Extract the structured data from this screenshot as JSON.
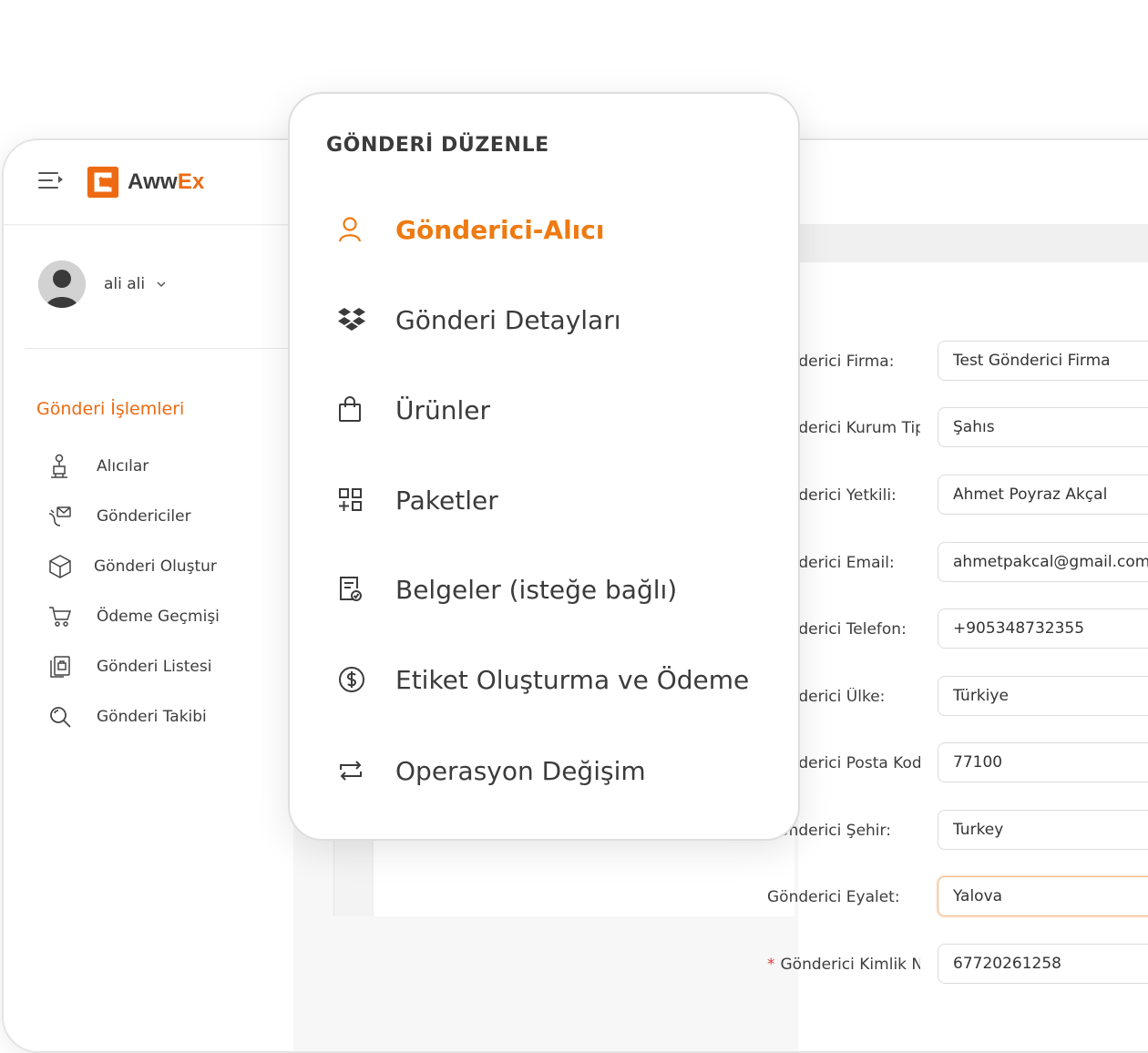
{
  "brand": {
    "name_part1": "Aww",
    "name_part2": "Ex",
    "accent": "#ee6a12"
  },
  "user": {
    "name": "ali ali"
  },
  "sidebar": {
    "section_title": "Gönderi İşlemleri",
    "items": [
      {
        "label": "Alıcılar",
        "icon": "receiver-icon"
      },
      {
        "label": "Göndericiler",
        "icon": "sender-icon"
      },
      {
        "label": "Gönderi Oluştur",
        "icon": "box-icon"
      },
      {
        "label": "Ödeme Geçmişi",
        "icon": "cart-icon"
      },
      {
        "label": "Gönderi Listesi",
        "icon": "list-icon"
      },
      {
        "label": "Gönderi Takibi",
        "icon": "search-icon"
      }
    ]
  },
  "popup": {
    "title": "GÖNDERİ DÜZENLE",
    "items": [
      {
        "label": "Gönderici-Alıcı",
        "icon": "user-icon",
        "active": true
      },
      {
        "label": "Gönderi Detayları",
        "icon": "dropbox-icon"
      },
      {
        "label": "Ürünler",
        "icon": "shopping-bag-icon"
      },
      {
        "label": "Paketler",
        "icon": "grid-add-icon"
      },
      {
        "label": "Belgeler (isteğe bağlı)",
        "icon": "document-check-icon"
      },
      {
        "label": "Etiket Oluşturma ve Ödeme",
        "icon": "dollar-circle-icon"
      },
      {
        "label": "Operasyon Değişim",
        "icon": "repeat-icon"
      }
    ]
  },
  "form": {
    "fields": [
      {
        "label": "Gönderici Firma:",
        "value": "Test Gönderici Firma"
      },
      {
        "label": "Gönderici Kurum Tipi:",
        "value": "Şahıs"
      },
      {
        "label": "Gönderici Yetkili:",
        "value": "Ahmet Poyraz Akçal"
      },
      {
        "label": "Gönderici Email:",
        "value": "ahmetpakcal@gmail.com"
      },
      {
        "label": "Gönderici Telefon:",
        "value": "+905348732355"
      },
      {
        "label": "Gönderici Ülke:",
        "value": "Türkiye"
      },
      {
        "label": "Gönderici Posta Kodu:",
        "value": "77100"
      },
      {
        "label": "Gönderici Şehir:",
        "value": "Turkey"
      },
      {
        "label": "Gönderici Eyalet:",
        "value": "Yalova"
      },
      {
        "label": "Gönderici Kimlik No:",
        "value": "67720261258",
        "required_mark": "*"
      }
    ]
  }
}
